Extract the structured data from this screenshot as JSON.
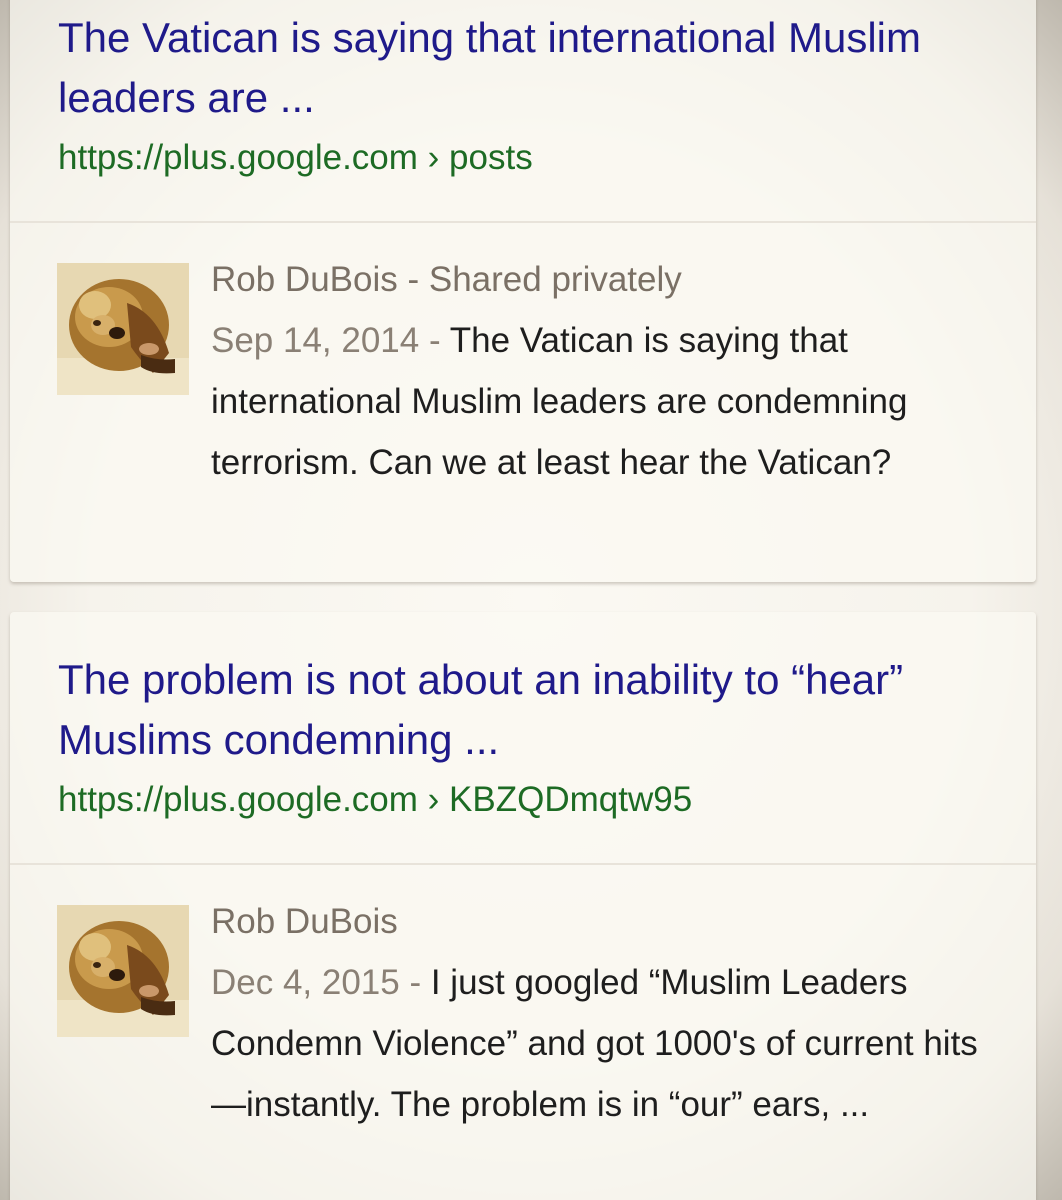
{
  "results": [
    {
      "title": "The Vatican is saying that international Muslim leaders are ...",
      "url": "https://plus.google.com › posts",
      "author": "Rob DuBois - Shared privately",
      "date": "Sep 14, 2014 - ",
      "snippet": "The Vatican is saying that international Muslim leaders are condemning terrorism. Can we at least hear the Vatican?"
    },
    {
      "title": "The problem is not about an inability to “hear” Muslims condemning ...",
      "url": "https://plus.google.com › KBZQDmqtw95",
      "author": "Rob DuBois",
      "date": "Dec 4, 2015 - ",
      "snippet": "I just googled “Muslim Leaders Condemn Violence” and got 1000's of current hits—instantly. The problem is in “our” ears, ..."
    }
  ],
  "colors": {
    "title": "#1f1a8a",
    "url": "#1d6b24",
    "meta": "#7a7065",
    "snippet": "#1e1e1e"
  },
  "avatar_icon": "lion-statue-avatar-icon"
}
